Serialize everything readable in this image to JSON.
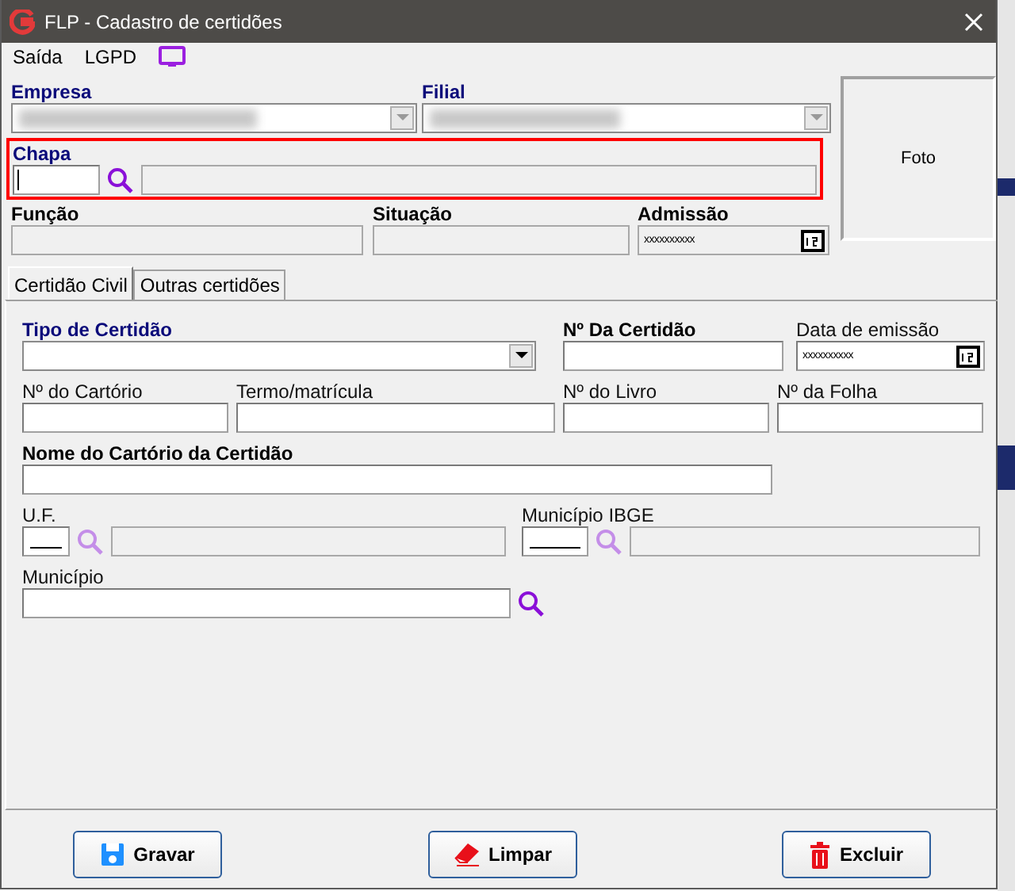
{
  "window": {
    "title": "FLP - Cadastro de certidões"
  },
  "menu": [
    {
      "label": "Saída"
    },
    {
      "label": "LGPD"
    }
  ],
  "header": {
    "empresa": {
      "label": "Empresa",
      "kind": "required"
    },
    "filial": {
      "label": "Filial",
      "kind": "required"
    },
    "chapa": {
      "label": "Chapa",
      "kind": "required",
      "highlighted": true,
      "focused": true
    },
    "funcao": {
      "label": "Função",
      "kind": "bold",
      "disabled": true
    },
    "situacao": {
      "label": "Situação",
      "kind": "bold",
      "disabled": true
    },
    "admissao": {
      "label": "Admissão",
      "kind": "bold",
      "disabled": true,
      "value": "xxxxxxxxxx"
    },
    "foto": "Foto"
  },
  "tabs": [
    {
      "label": "Certidão Civil",
      "selected": true
    },
    {
      "label": "Outras certidões",
      "selected": false
    }
  ],
  "form": {
    "tipo": {
      "label": "Tipo de Certidão",
      "kind": "required"
    },
    "numero_certidao": {
      "label": "Nº Da Certidão",
      "kind": "bold"
    },
    "data_emissao": {
      "label": "Data de emissão",
      "kind": "normal",
      "value": "xxxxxxxxxx"
    },
    "cartorio": {
      "label": "Nº do Cartório",
      "kind": "normal"
    },
    "termo": {
      "label": "Termo/matrícula",
      "kind": "normal"
    },
    "livro": {
      "label": "Nº do Livro",
      "kind": "normal"
    },
    "folha": {
      "label": "Nº da Folha",
      "kind": "normal"
    },
    "nome_cartorio": {
      "label": "Nome do Cartório da Certidão",
      "kind": "bold"
    },
    "uf": {
      "label": "U.F.",
      "kind": "normal",
      "search_disabled": true
    },
    "municipio_ibge": {
      "label": "Município IBGE",
      "kind": "normal",
      "search_disabled": true
    },
    "municipio": {
      "label": "Município",
      "kind": "normal",
      "search_disabled": false
    }
  },
  "buttons": [
    {
      "label": "Gravar",
      "kind": "save"
    },
    {
      "label": "Limpar",
      "kind": "clear"
    },
    {
      "label": "Excluir",
      "kind": "delete"
    }
  ]
}
